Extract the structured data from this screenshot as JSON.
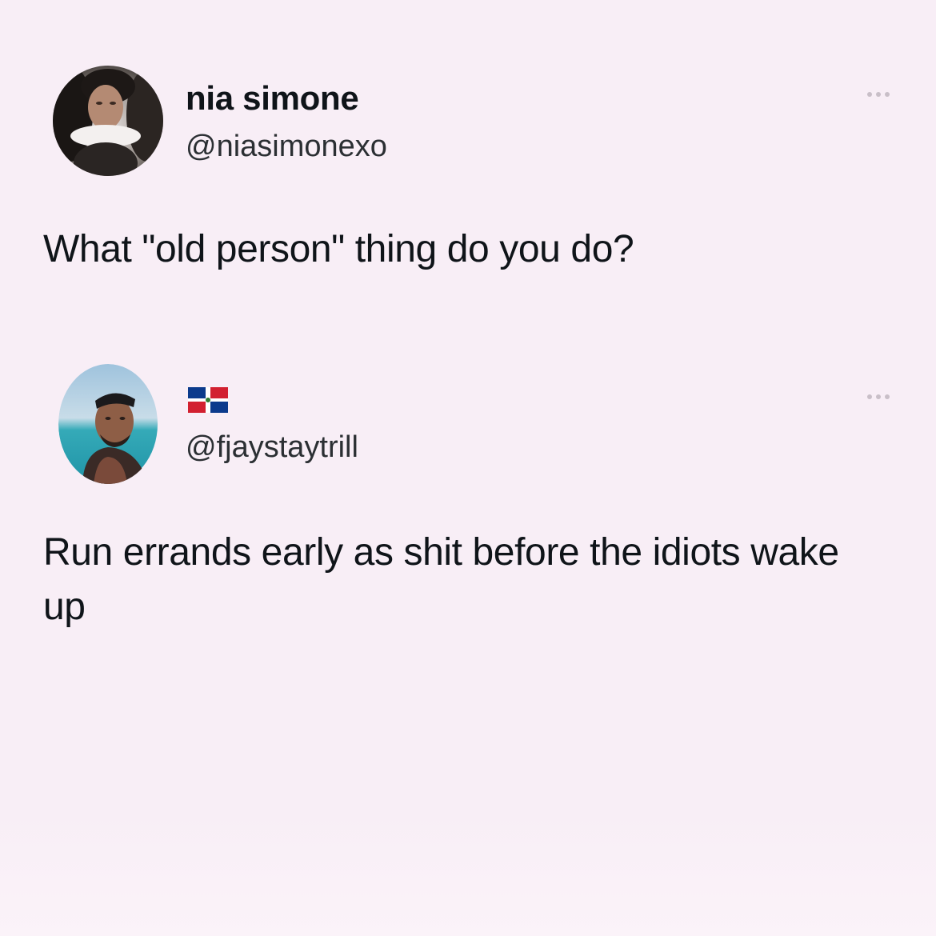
{
  "tweets": [
    {
      "name": "nia simone",
      "handle": "@niasimonexo",
      "text": "What \"old person\" thing do you do?",
      "avatar": "woman-portrait-avatar",
      "more_icon": "more-options-icon"
    },
    {
      "name": "",
      "flag": "dominican-republic-flag-icon",
      "handle": "@fjaystaytrill",
      "text": "Run errands early as shit before the idiots wake up",
      "avatar": "man-beach-portrait-avatar",
      "more_icon": "more-options-icon"
    }
  ],
  "colors": {
    "background": "#f8eef6",
    "text": "#0f1419",
    "handle": "#2b2f33",
    "dots": "#c9bfc8"
  }
}
